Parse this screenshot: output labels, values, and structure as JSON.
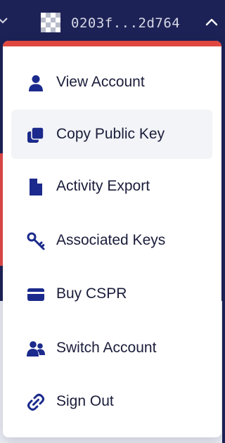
{
  "header": {
    "account_hash": "0203f...2d764"
  },
  "menu": {
    "items": [
      {
        "label": "View Account",
        "icon": "user-icon"
      },
      {
        "label": "Copy Public Key",
        "icon": "copy-icon"
      },
      {
        "label": "Activity Export",
        "icon": "file-icon"
      },
      {
        "label": "Associated Keys",
        "icon": "key-icon"
      },
      {
        "label": "Buy CSPR",
        "icon": "credit-card-icon"
      },
      {
        "label": "Switch Account",
        "icon": "users-icon"
      },
      {
        "label": "Sign Out",
        "icon": "unlink-icon"
      }
    ],
    "highlighted_item": "Copy Public Key"
  },
  "colors": {
    "header_bg": "#1d2256",
    "accent": "#e0473f",
    "icon": "#1b2a8c",
    "text": "#1a1d3a",
    "hover_bg": "#f3f4f7"
  }
}
